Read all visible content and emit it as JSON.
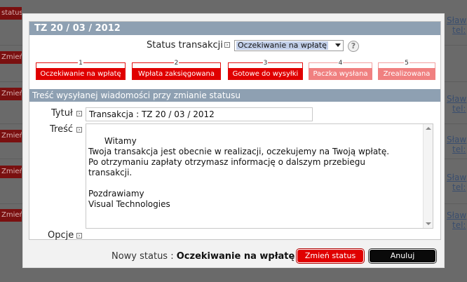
{
  "background": {
    "tags": [
      "status",
      "Zmień sta",
      "Zmień sta",
      "Zmień sta",
      "Zmień sta",
      "Zmień sta"
    ],
    "links": [
      "Sław",
      "tel:",
      "Sław",
      "tel:",
      "Sław",
      "tel:",
      "Sław",
      "tel:",
      "Sław",
      "tel:"
    ]
  },
  "modal": {
    "title": "TZ 20 / 03 / 2012",
    "status_label": "Status transakcji",
    "status_value": "Oczekiwanie na wpłatę",
    "help_icon": "?",
    "steps": [
      {
        "num": "1",
        "label": "Oczekiwanie na wpłatę",
        "active": true
      },
      {
        "num": "2",
        "label": "Wpłata zaksięgowana",
        "active": true
      },
      {
        "num": "3",
        "label": "Gotowe do wysyłki",
        "active": true
      },
      {
        "num": "4",
        "label": "Paczka wysłana",
        "active": false
      },
      {
        "num": "5",
        "label": "Zrealizowana",
        "active": false
      }
    ],
    "section_header": "Treść wysyłanej wiadomości przy zmianie statusu",
    "title_label": "Tytuł",
    "title_value": "Transakcja : TZ 20 / 03 / 2012",
    "content_label": "Treść",
    "content_value": "Witamy\nTwoja transakcja jest obecnie w realizacji, oczekujemy na Twoją wpłatę.\nPo otrzymaniu zapłaty otrzymasz informację o dalszym przebiegu\ntransakcji.\n\nPozdrawiamy\nVisual Technologies",
    "options_label": "Opcje",
    "footer": {
      "new_status_label": "Nowy status :",
      "new_status_value": "Oczekiwanie na wpłatę",
      "change_button": "Zmień status",
      "cancel_button": "Anuluj"
    },
    "colors": {
      "header": "#8ea0b2",
      "active_step": "#e00000",
      "inactive_step": "#f08080"
    }
  }
}
